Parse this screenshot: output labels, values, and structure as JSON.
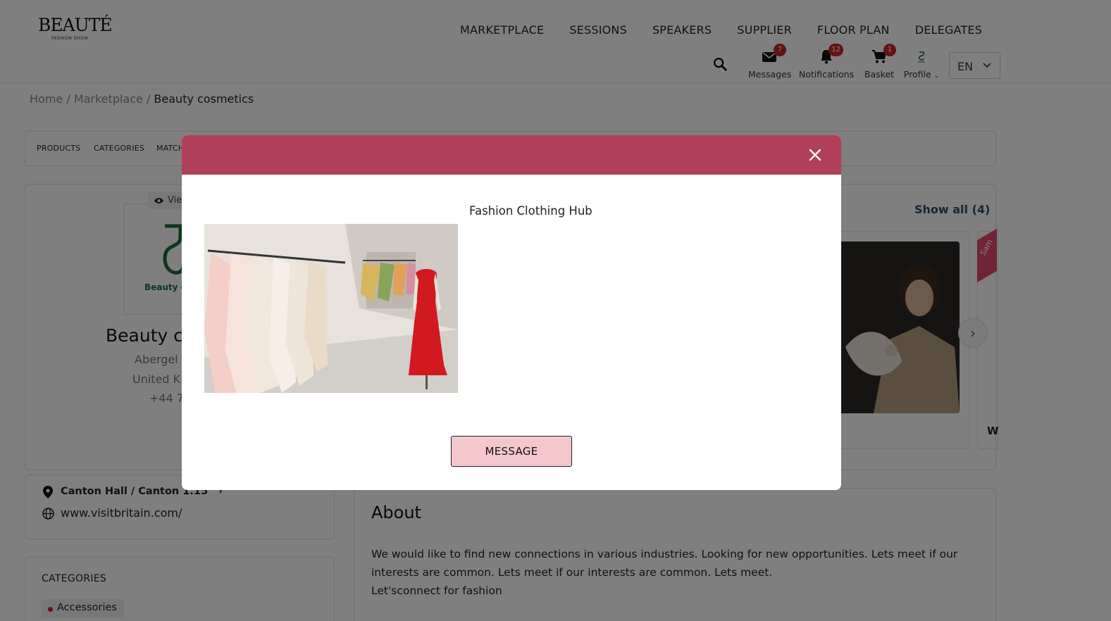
{
  "brand": {
    "title": "BEAUTÉ",
    "subtitle": "FASHION SHOW"
  },
  "nav": [
    "MARKETPLACE",
    "SESSIONS",
    "SPEAKERS",
    "SUPPLIER",
    "FLOOR PLAN",
    "DELEGATES"
  ],
  "header_icons": {
    "messages": {
      "label": "Messages",
      "badge": "7"
    },
    "notifications": {
      "label": "Notifications",
      "badge": "12"
    },
    "basket": {
      "label": "Basket",
      "badge": "1"
    },
    "profile": {
      "label": "Profile"
    }
  },
  "language": "EN",
  "breadcrumb": {
    "home": "Home",
    "sep": " / ",
    "marketplace": "Marketplace",
    "current": "Beauty cosmetics"
  },
  "tabs": [
    "PRODUCTS",
    "CATEGORIES",
    "MATCH"
  ],
  "company": {
    "views_label": "Vie",
    "logo_text": "Beauty c",
    "name": "Beauty c",
    "city": "Abergel",
    "country": "United K",
    "phone": "+44 7"
  },
  "products": {
    "show_all": "Show all (4)",
    "ribbon": "Sam",
    "next_title": "W"
  },
  "location": {
    "hall": "Canton Hall / Canton 1.15",
    "website": "www.visitbritain.com/"
  },
  "categories": {
    "title": "CATEGORIES",
    "items": [
      "Accessories"
    ]
  },
  "about": {
    "title": "About",
    "text": "We would like to find new connections in various industries. Looking for new opportunities. Lets meet if our interests are common. Lets meet if our interests are common. Lets meet.",
    "text2": "Let'sconnect for fashion"
  },
  "modal": {
    "caption": "Fashion Clothing Hub",
    "button": "MESSAGE",
    "header_color": "#b23f59",
    "button_color": "#f4c7cd"
  }
}
